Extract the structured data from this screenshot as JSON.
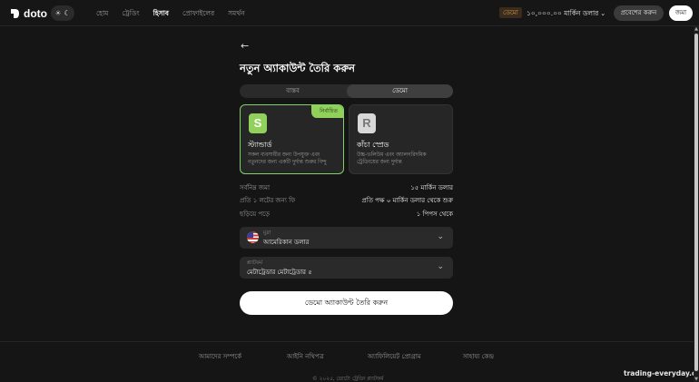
{
  "brand": {
    "name": "doto"
  },
  "nav": {
    "items": [
      {
        "label": "হোম"
      },
      {
        "label": "ট্রেডিং"
      },
      {
        "label": "হিসাব"
      },
      {
        "label": "প্রোফাইলের"
      },
      {
        "label": "সমর্থন"
      }
    ],
    "active_index": 2
  },
  "header": {
    "demo_badge": "ডেমো",
    "balance": "১০,০০০.০০ মার্কিন ডলার",
    "login_button": "প্রবেশের করুন",
    "deposit_button": "জমা"
  },
  "page": {
    "title": "নতুন অ্যাকাউন্ট তৈরি করুন",
    "account_type": {
      "real_label": "বাস্তব",
      "demo_label": "ডেমো",
      "selected": "demo"
    },
    "cards": [
      {
        "letter": "S",
        "name": "স্ট্যান্ডার্ড",
        "desc": "সকল ব্যবসায়ীর জন্য উপযুক্ত এবং নতুনদের জন্য একটি দুর্দান্ত শুরুর বিন্দু",
        "badge": "নির্বাচিত",
        "selected": true
      },
      {
        "letter": "R",
        "name": "কাঁচা স্প্রেড",
        "desc": "উচ্চ-ভলিউম এবং অ্যালগরিদমিক ট্রেডিংয়ের জন্য দুর্দান্ত",
        "selected": false
      }
    ],
    "info": [
      {
        "label": "সর্বনিম্ন জমা",
        "value": "১৫ মার্কিন ডলার"
      },
      {
        "label": "প্রতি ১ লটের জন্য ফি",
        "value": "প্রতি পক্ষ ০ মার্কিন ডলার থেকে শুরু"
      },
      {
        "label": "ছড়িয়ে পড়ে",
        "value": "১ পিপস থেকে"
      }
    ],
    "currency": {
      "label": "মুদ্রা",
      "value": "আমেরিকান ডলার"
    },
    "platform": {
      "label": "প্ল্যাটফর্ম",
      "value": "মেটাট্রেডার মেটাট্রেডার ৫"
    },
    "submit_button": "ডেমো অ্যাকাউন্ট তৈরি করুন"
  },
  "footer": {
    "links": [
      {
        "label": "আমাদের সম্পর্কে"
      },
      {
        "label": "আইনি নথিপত্র"
      },
      {
        "label": "অ্যাফিলিয়েট প্রোগ্রাম"
      },
      {
        "label": "সাহায্য কেন্দ্র"
      }
    ],
    "copyright": "© ২০২৫, ডোটো ট্রেডিং প্ল্যাটফর্ম"
  },
  "watermark": "trading-everyday.com",
  "colors": {
    "accent_green": "#8fd15a",
    "background": "#151515",
    "demo_badge": "#d29a5a"
  },
  "icons": [
    "doto-logo-icon",
    "sun-icon",
    "moon-icon",
    "chevron-down-icon",
    "arrow-left-icon",
    "us-flag-icon"
  ]
}
